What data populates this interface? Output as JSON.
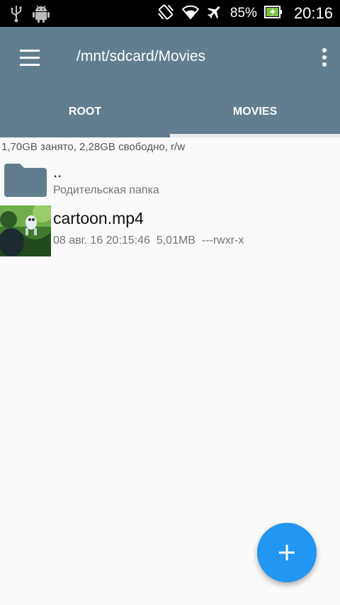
{
  "status_bar": {
    "battery_percent": "85%",
    "time": "20:16",
    "icons": [
      "usb-icon",
      "android-debug-icon",
      "vibrate-icon",
      "wifi-icon",
      "airplane-icon",
      "battery-charging-icon"
    ]
  },
  "toolbar": {
    "title": "/mnt/sdcard/Movies",
    "menu_icon": "hamburger-menu-icon",
    "overflow_icon": "more-vert-icon"
  },
  "tabs": [
    {
      "label": "ROOT",
      "active": false
    },
    {
      "label": "MOVIES",
      "active": true
    }
  ],
  "storage_info": "1,70GB занято, 2,28GB свободно, r/w",
  "files": [
    {
      "name": "..",
      "subtitle": "Родительская папка",
      "icon": "folder-icon"
    },
    {
      "name": "cartoon.mp4",
      "date": "08 авг. 16 20:15:46",
      "size": "5,01MB",
      "permissions": "---rwxr-x",
      "meta": "08 авг. 16 20:15:46  5,01MB  ---rwxr-x",
      "icon": "video-thumbnail"
    }
  ],
  "fab": {
    "icon": "add-icon"
  },
  "colors": {
    "toolbar": "#627e8e",
    "background": "#fafafa",
    "fab": "#2196f3",
    "folder": "#627e8e"
  }
}
